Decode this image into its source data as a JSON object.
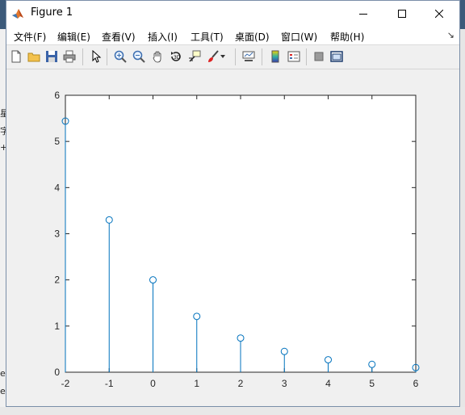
{
  "window": {
    "title": "Figure 1",
    "controls": {
      "minimize": "minimize",
      "maximize": "maximize",
      "close": "close"
    }
  },
  "menu": {
    "items": [
      "文件(F)",
      "编辑(E)",
      "查看(V)",
      "插入(I)",
      "工具(T)",
      "桌面(D)",
      "窗口(W)",
      "帮助(H)"
    ]
  },
  "toolbar": {
    "buttons": [
      "new-figure",
      "open-file",
      "save-figure",
      "print-figure",
      "edit-plot-arrow",
      "zoom-in",
      "zoom-out",
      "pan-hand",
      "rotate-3d",
      "data-cursor",
      "brush-data",
      "link-plot",
      "insert-colorbar",
      "insert-legend",
      "hide-plot-tools",
      "show-plot-tools"
    ]
  },
  "background": {
    "left_snippets": [
      "星",
      "字",
      "+",
      "eS",
      "e,"
    ]
  },
  "chart_data": {
    "type": "stem",
    "title": "",
    "xlabel": "",
    "ylabel": "",
    "x": [
      -2,
      -1,
      0,
      1,
      2,
      3,
      4,
      5,
      6
    ],
    "y": [
      5.44,
      3.3,
      2.0,
      1.21,
      0.74,
      0.45,
      0.27,
      0.17,
      0.1
    ],
    "xlim": [
      -2,
      6
    ],
    "ylim": [
      0,
      6
    ],
    "xticks": [
      "-2",
      "-1",
      "0",
      "1",
      "2",
      "3",
      "4",
      "5",
      "6"
    ],
    "yticks": [
      "0",
      "1",
      "2",
      "3",
      "4",
      "5",
      "6"
    ],
    "marker": "circle",
    "color": "#0072bd",
    "grid": false
  }
}
